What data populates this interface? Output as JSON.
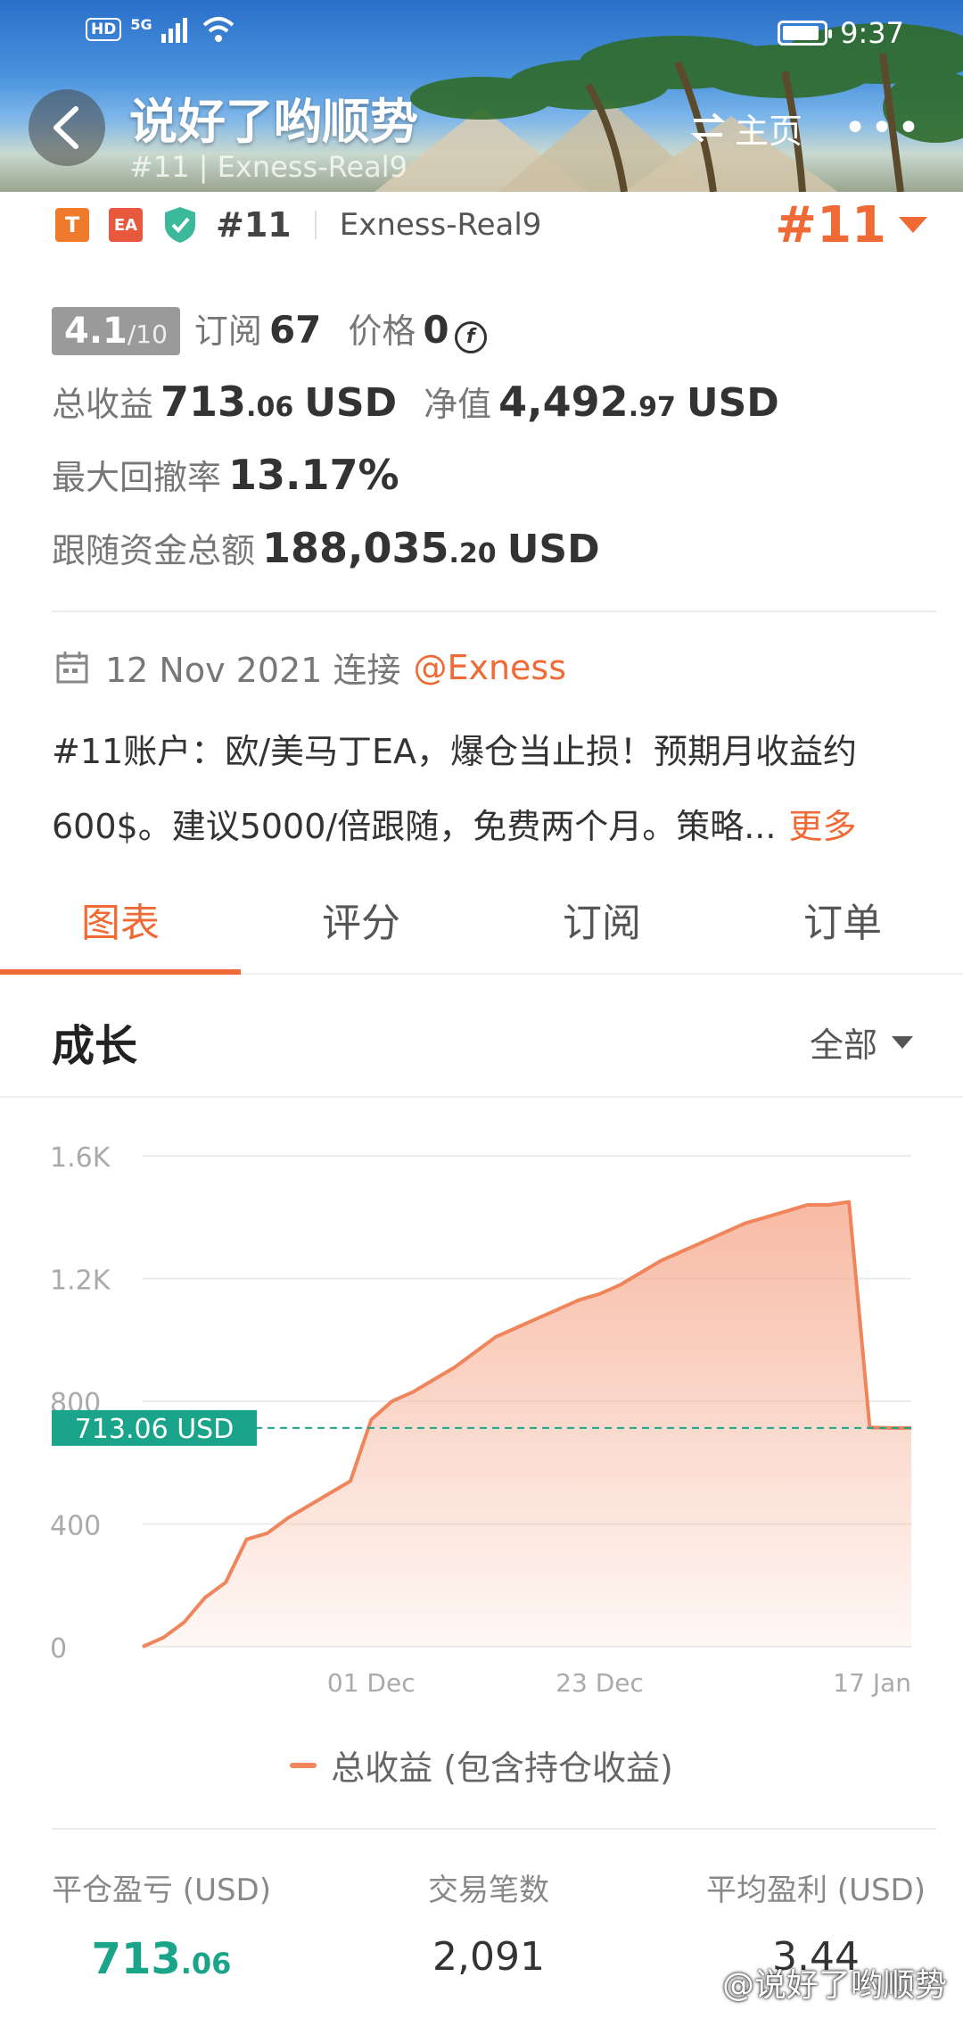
{
  "status_bar": {
    "network": "5G",
    "hd": "HD",
    "time": "9:37"
  },
  "header": {
    "title": "说好了哟顺势",
    "subtitle": "#11 | Exness-Real9",
    "home_label": "主页",
    "more_label": "•••"
  },
  "account": {
    "tag_t": "T",
    "tag_ea": "EA",
    "number": "#11",
    "server": "Exness-Real9",
    "rank": "#11"
  },
  "stats": {
    "score": "4.1",
    "score_max": "/10",
    "subs_label": "订阅",
    "subs_value": "67",
    "price_label": "价格",
    "price_value": "0",
    "coin_symbol": "f",
    "profit_label": "总收益",
    "profit_int": "713",
    "profit_dec": ".06",
    "profit_unit": "USD",
    "equity_label": "净值",
    "equity_int": "4,492",
    "equity_dec": ".97",
    "equity_unit": "USD",
    "drawdown_label": "最大回撤率",
    "drawdown_value": "13.17%",
    "follow_label": "跟随资金总额",
    "follow_int": "188,035",
    "follow_dec": ".20",
    "follow_unit": "USD"
  },
  "info": {
    "date_text": "12 Nov 2021 连接",
    "broker_link": "@Exness",
    "description_line1": "#11账户：欧/美马丁EA，爆仓当止损！预期月收益约",
    "description_line2": "600$。建议5000/倍跟随，免费两个月。策略...",
    "more_link": "更多"
  },
  "tabs": [
    {
      "label": "图表",
      "active": true
    },
    {
      "label": "评分",
      "active": false
    },
    {
      "label": "订阅",
      "active": false
    },
    {
      "label": "订单",
      "active": false
    }
  ],
  "section": {
    "title": "成长",
    "range": "全部"
  },
  "chart_data": {
    "type": "area",
    "y_ticks": [
      "0",
      "400",
      "800",
      "1.2K",
      "1.6K"
    ],
    "ylim": [
      0,
      1600
    ],
    "x_ticks": [
      "01 Dec",
      "23 Dec",
      "17 Jan"
    ],
    "current_label": "713.06 USD",
    "current_value": 713.06,
    "series": [
      {
        "name": "总收益 (包含持仓收益)",
        "x": [
          "12 Nov",
          "14 Nov",
          "16 Nov",
          "18 Nov",
          "19 Nov",
          "21 Nov",
          "23 Nov",
          "25 Nov",
          "27 Nov",
          "29 Nov",
          "30 Nov",
          "01 Dec",
          "03 Dec",
          "05 Dec",
          "07 Dec",
          "09 Dec",
          "11 Dec",
          "13 Dec",
          "15 Dec",
          "17 Dec",
          "19 Dec",
          "21 Dec",
          "23 Dec",
          "25 Dec",
          "27 Dec",
          "29 Dec",
          "31 Dec",
          "02 Jan",
          "04 Jan",
          "06 Jan",
          "08 Jan",
          "10 Jan",
          "12 Jan",
          "14 Jan",
          "15 Jan",
          "16 Jan",
          "17 Jan",
          "18 Jan"
        ],
        "values": [
          0,
          30,
          80,
          160,
          210,
          350,
          370,
          420,
          460,
          500,
          540,
          740,
          800,
          830,
          870,
          910,
          960,
          1010,
          1040,
          1070,
          1100,
          1130,
          1150,
          1180,
          1220,
          1260,
          1290,
          1320,
          1350,
          1380,
          1400,
          1420,
          1440,
          1440,
          1450,
          715,
          713,
          713
        ]
      }
    ],
    "legend": "总收益 (包含持仓收益)"
  },
  "summary": [
    {
      "label": "平仓盈亏 (USD)",
      "int": "713",
      "dec": ".06"
    },
    {
      "label": "交易笔数",
      "value": "2,091"
    },
    {
      "label": "平均盈利 (USD)",
      "value": "3.44"
    }
  ],
  "watermark": "@说好了哟顺势",
  "colors": {
    "accent": "#f06a35",
    "green": "#1aa58a",
    "area": "#f5a486"
  }
}
